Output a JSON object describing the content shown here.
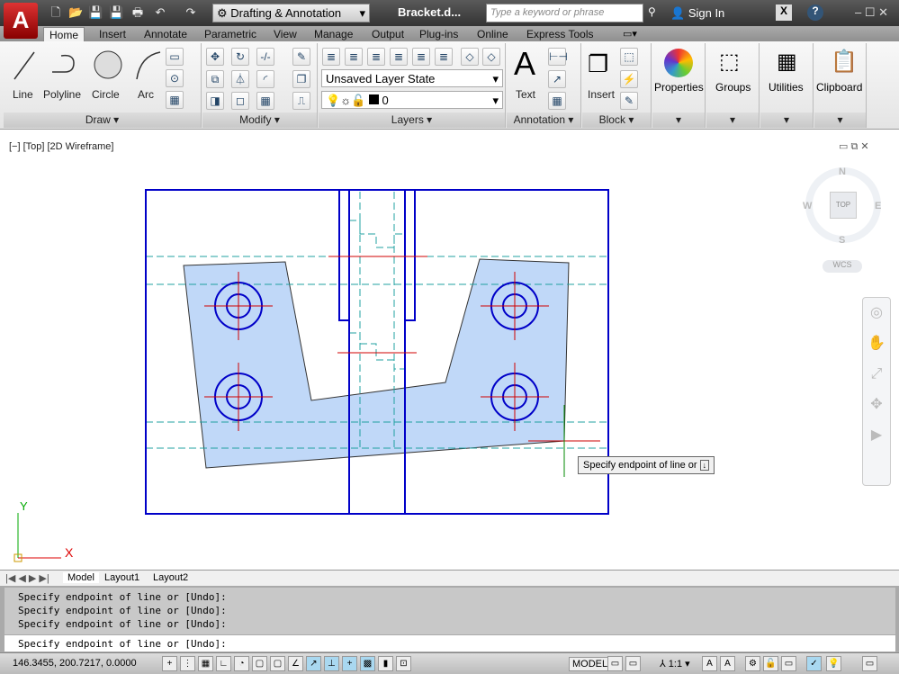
{
  "title_bar": {
    "app_menu": "A",
    "workspace": "Drafting & Annotation",
    "document": "Bracket.d...",
    "search_placeholder": "Type a keyword or phrase",
    "sign_in": "Sign In"
  },
  "tabs": [
    "Home",
    "Insert",
    "Annotate",
    "Parametric",
    "View",
    "Manage",
    "Output",
    "Plug-ins",
    "Online",
    "Express Tools"
  ],
  "ribbon": {
    "draw": {
      "title": "Draw",
      "tools": [
        "Line",
        "Polyline",
        "Circle",
        "Arc"
      ]
    },
    "modify": {
      "title": "Modify"
    },
    "layers": {
      "title": "Layers",
      "layer_state": "Unsaved Layer State",
      "current_layer": "0"
    },
    "annotation": {
      "title": "Annotation",
      "text": "Text"
    },
    "block": {
      "title": "Block",
      "insert": "Insert"
    },
    "properties": "Properties",
    "groups": "Groups",
    "utilities": "Utilities",
    "clipboard": "Clipboard"
  },
  "viewport": {
    "label": "[−] [Top] [2D Wireframe]",
    "tooltip": "Specify endpoint of line or",
    "viewcube": {
      "n": "N",
      "s": "S",
      "e": "E",
      "w": "W",
      "top": "TOP",
      "wcs": "WCS"
    },
    "ucs": {
      "x": "X",
      "y": "Y"
    }
  },
  "layout_tabs": [
    "Model",
    "Layout1",
    "Layout2"
  ],
  "command": {
    "history": [
      "Specify endpoint of line or [Undo]:",
      "Specify endpoint of line or [Undo]:",
      "Specify endpoint of line or [Undo]:"
    ],
    "prompt": "Specify endpoint of line or [Undo]:"
  },
  "status": {
    "coords": "146.3455, 200.7217, 0.0000",
    "model": "MODEL",
    "scale": "1:1"
  },
  "colors": {
    "outline": "#0000c8",
    "fill": "#c0d8f8",
    "hidden": "#20a0a0",
    "center": "#d00000"
  }
}
